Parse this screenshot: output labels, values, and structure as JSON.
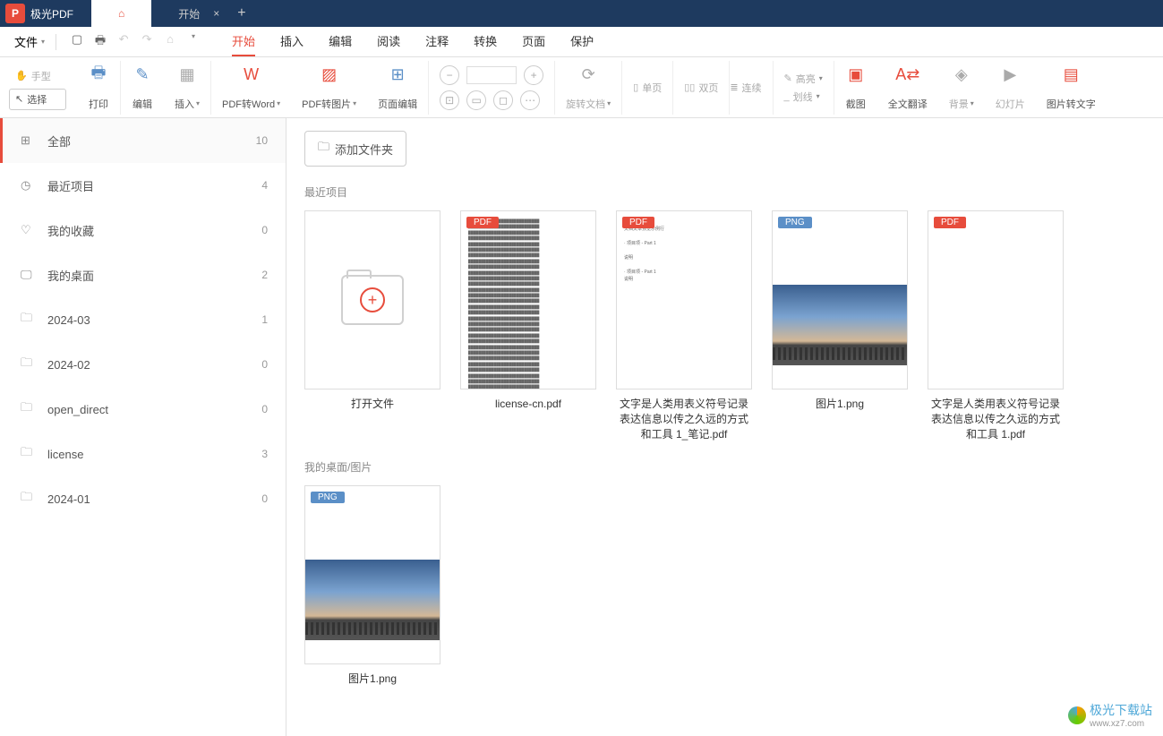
{
  "app": {
    "name": "极光PDF"
  },
  "tabs": [
    {
      "label": "",
      "icon": "home",
      "active": true
    },
    {
      "label": "开始",
      "active": false
    }
  ],
  "menubar": {
    "file": "文件",
    "items": [
      "开始",
      "插入",
      "编辑",
      "阅读",
      "注释",
      "转换",
      "页面",
      "保护"
    ],
    "active_index": 0
  },
  "modes": {
    "hand": "手型",
    "select": "选择"
  },
  "ribbon": {
    "print": "打印",
    "edit": "编辑",
    "insert": "插入",
    "pdf2word": "PDF转Word",
    "pdf2img": "PDF转图片",
    "pageedit": "页面编辑",
    "rotate": "旋转文档",
    "single": "单页",
    "double": "双页",
    "continuous": "连续",
    "highlight": "高亮",
    "underline": "划线",
    "screenshot": "截图",
    "translate": "全文翻译",
    "background": "背景",
    "slideshow": "幻灯片",
    "img2text": "图片转文字"
  },
  "sidebar": [
    {
      "icon": "grid",
      "label": "全部",
      "count": 10,
      "active": true
    },
    {
      "icon": "clock",
      "label": "最近项目",
      "count": 4
    },
    {
      "icon": "heart",
      "label": "我的收藏",
      "count": 0
    },
    {
      "icon": "monitor",
      "label": "我的桌面",
      "count": 2
    },
    {
      "icon": "folder",
      "label": "2024-03",
      "count": 1
    },
    {
      "icon": "folder",
      "label": "2024-02",
      "count": 0
    },
    {
      "icon": "folder",
      "label": "open_direct",
      "count": 0
    },
    {
      "icon": "folder",
      "label": "license",
      "count": 3
    },
    {
      "icon": "folder",
      "label": "2024-01",
      "count": 0
    }
  ],
  "content": {
    "add_folder": "添加文件夹",
    "sections": [
      {
        "title": "最近项目",
        "files": [
          {
            "type": "open",
            "name": "打开文件"
          },
          {
            "type": "pdf",
            "name": "license-cn.pdf",
            "preview": "doc"
          },
          {
            "type": "pdf",
            "name": "文字是人类用表义符号记录表达信息以传之久远的方式和工具 1_笔记.pdf",
            "preview": "doc-small"
          },
          {
            "type": "png",
            "name": "图片1.png",
            "preview": "sky"
          },
          {
            "type": "pdf",
            "name": "文字是人类用表义符号记录表达信息以传之久远的方式和工具 1.pdf",
            "preview": "blank"
          }
        ]
      },
      {
        "title": "我的桌面/图片",
        "files": [
          {
            "type": "png",
            "name": "图片1.png",
            "preview": "sky"
          }
        ]
      }
    ]
  },
  "watermark": {
    "text": "极光下载站",
    "url": "www.xz7.com"
  }
}
